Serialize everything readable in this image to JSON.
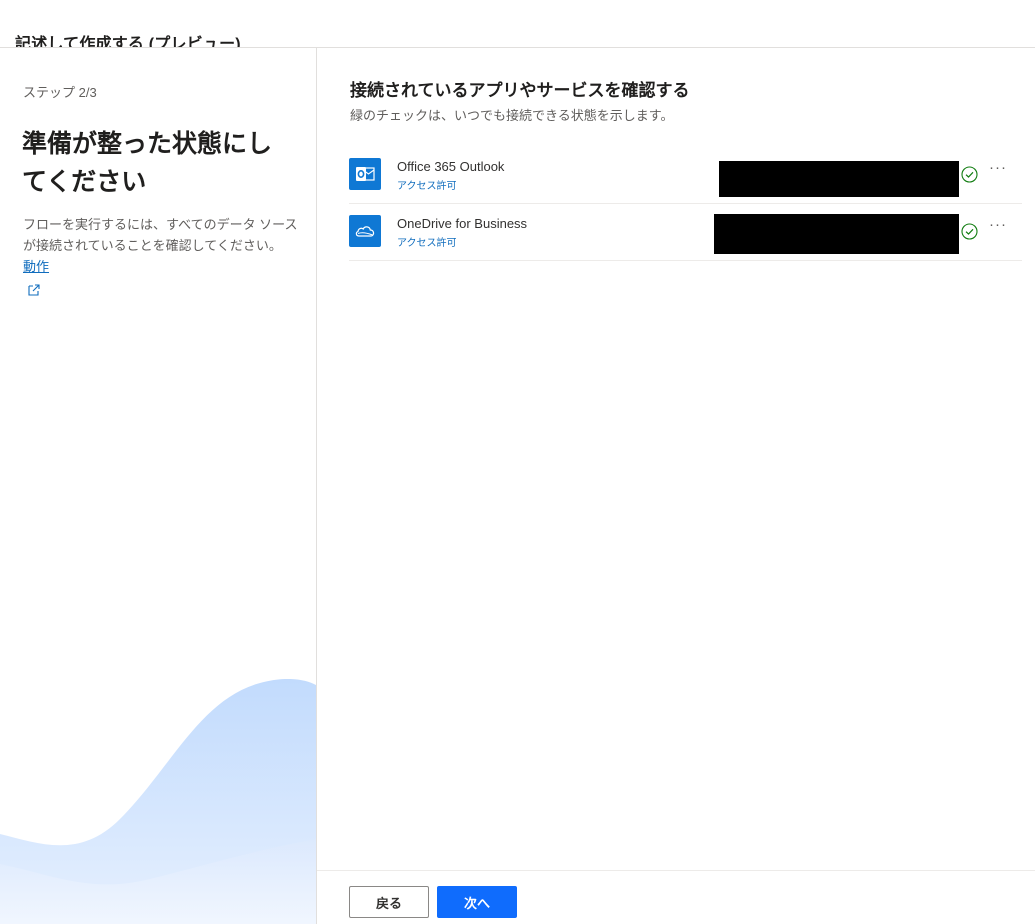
{
  "window": {
    "title": "記述して作成する (プレビュー)"
  },
  "left": {
    "step": "ステップ 2/3",
    "heading": "準備が整った状態にしてください",
    "description": "フローを実行するには、すべてのデータ ソースが接続されていることを確認してください。",
    "link_label": "動作"
  },
  "main": {
    "title": "接続されているアプリやサービスを確認する",
    "subtitle": "緑のチェックは、いつでも接続できる状態を示します。",
    "connections": [
      {
        "name": "Office 365 Outlook",
        "access_label": "アクセス許可",
        "icon": "outlook-icon",
        "status": "connected",
        "more_label": "···"
      },
      {
        "name": "OneDrive for Business",
        "access_label": "アクセス許可",
        "icon": "onedrive-icon",
        "status": "connected",
        "more_label": "···"
      }
    ]
  },
  "footer": {
    "back_label": "戻る",
    "next_label": "次へ"
  },
  "colors": {
    "accent": "#0f6cbd",
    "primary_button": "#0f6cfd",
    "check": "#107c10",
    "redaction": "#000000"
  }
}
